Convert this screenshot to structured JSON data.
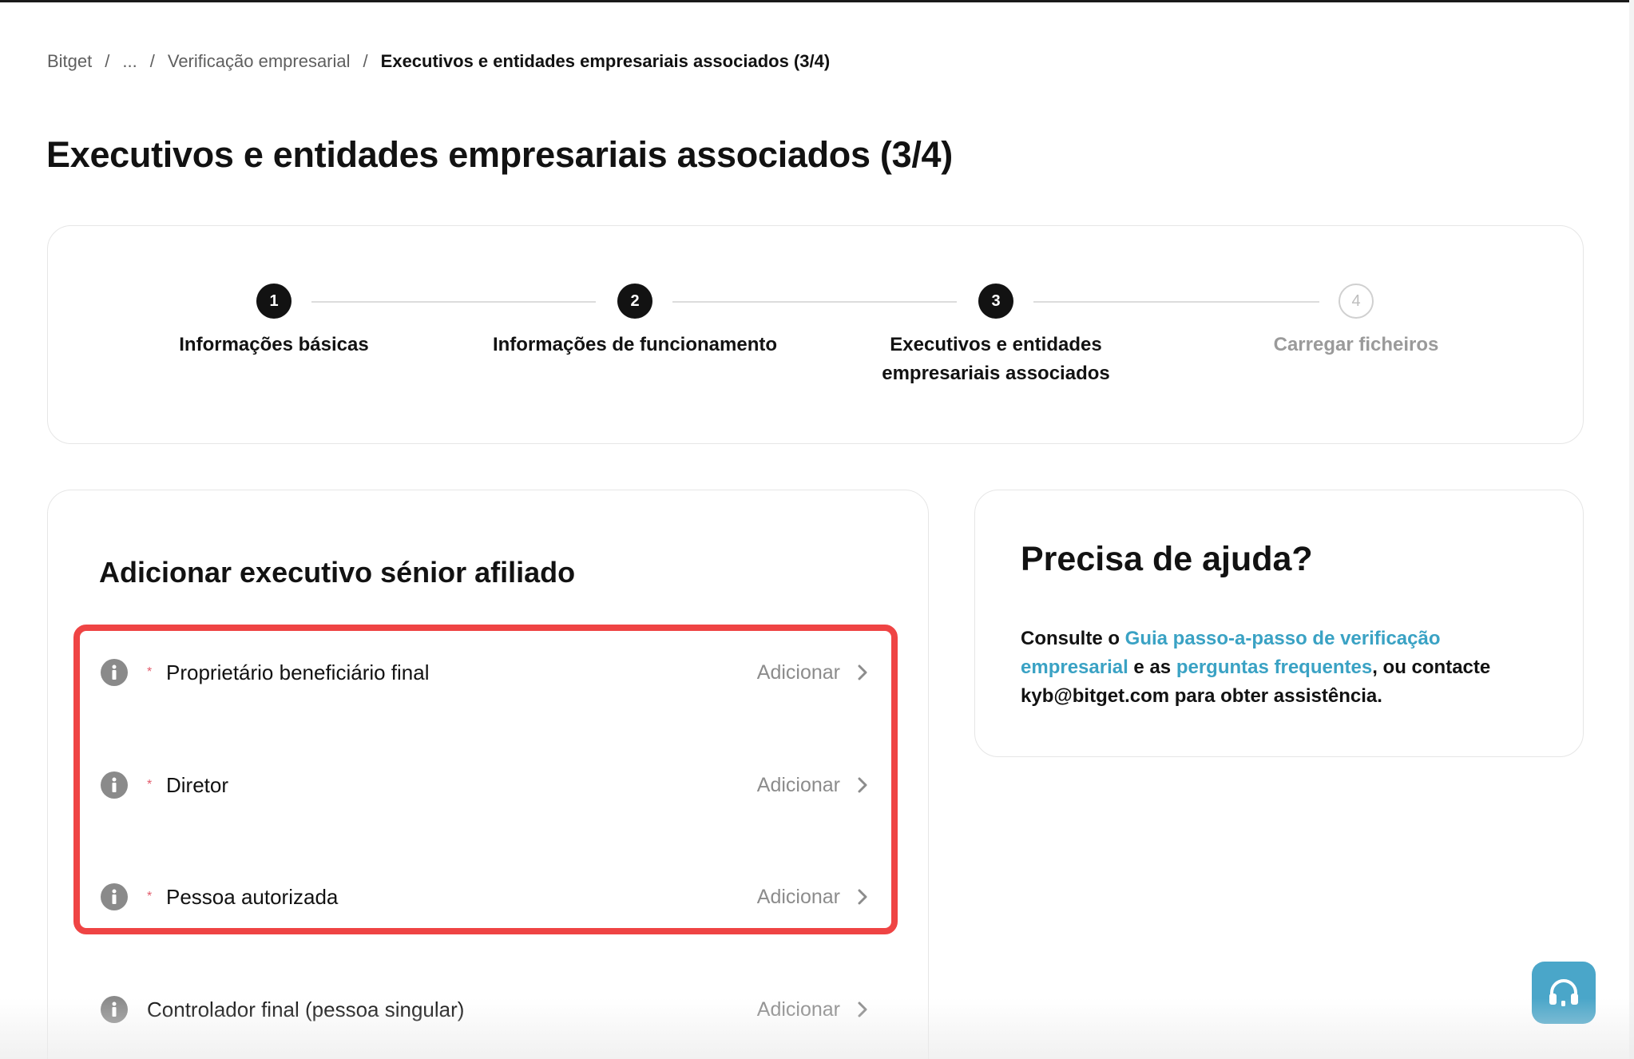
{
  "breadcrumb": {
    "items": [
      "Bitget",
      "...",
      "Verificação empresarial"
    ],
    "current": "Executivos e entidades empresariais associados (3/4)",
    "separator": "/"
  },
  "page_title": "Executivos e entidades empresariais associados (3/4)",
  "stepper": {
    "steps": [
      {
        "number": "1",
        "label": "Informações básicas",
        "status": "done"
      },
      {
        "number": "2",
        "label": "Informações de funcionamento",
        "status": "done"
      },
      {
        "number": "3",
        "label": "Executivos e entidades empresariais associados",
        "status": "current"
      },
      {
        "number": "4",
        "label": "Carregar ficheiros",
        "status": "todo"
      }
    ]
  },
  "executives": {
    "title": "Adicionar executivo sénior afiliado",
    "add_label": "Adicionar",
    "rows": [
      {
        "label": "Proprietário beneficiário final",
        "required": true
      },
      {
        "label": "Diretor",
        "required": true
      },
      {
        "label": "Pessoa autorizada",
        "required": true
      },
      {
        "label": "Controlador final (pessoa singular)",
        "required": false
      }
    ],
    "required_mark": "*"
  },
  "help": {
    "title": "Precisa de ajuda?",
    "text_1": "Consulte o ",
    "link_guide": "Guia passo-a-passo de verificação empresarial",
    "text_2": " e as ",
    "link_faq": "perguntas frequentes",
    "text_3": ", ou contacte kyb@bitget.com para obter assistência."
  },
  "colors": {
    "accent_link": "#3aa2c4",
    "highlight_border": "#ef4444",
    "support_button": "#4aa6c9"
  },
  "icons": {
    "info": "info-icon",
    "chevron": "chevron-right-icon",
    "support": "headset-icon"
  }
}
